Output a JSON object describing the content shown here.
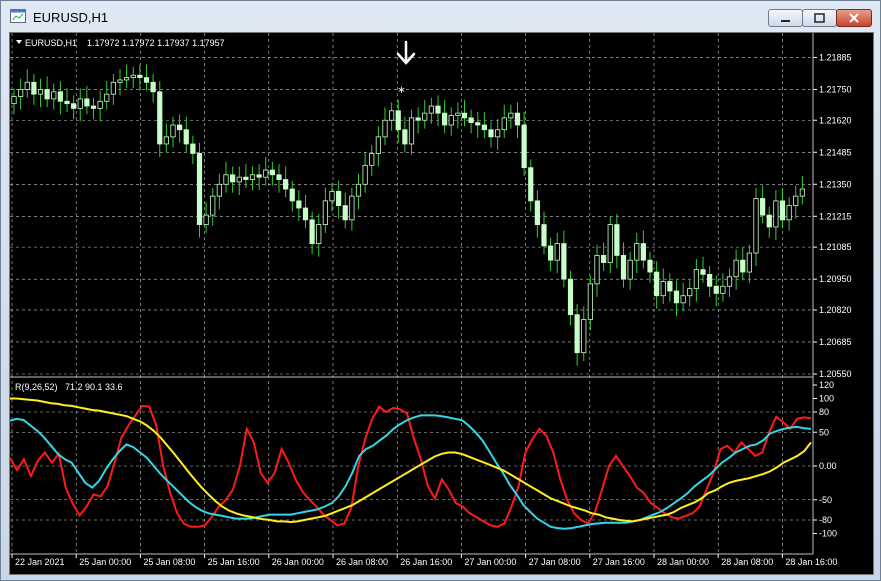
{
  "window": {
    "title": "EURUSD,H1",
    "buttons": [
      "minimize",
      "restore",
      "close"
    ]
  },
  "main_chart": {
    "symbol_label": "EURUSD,H1",
    "ohlc_label": "1.17972 1.17972 1.17937 1.17957"
  },
  "indicator": {
    "label": "R(9,26,52)",
    "values_label": "71.2 90.1 33.6"
  },
  "colors": {
    "background": "#000000",
    "grid": "#c8c8c8",
    "candle": "#c8ffc8",
    "wick": "#32cd32",
    "fast": "#ff1a1a",
    "mid": "#33d6e6",
    "slow": "#ffef1a"
  },
  "chart_data": [
    {
      "type": "candlestick",
      "title": "EURUSD,H1",
      "yticks": [
        "1.21885",
        "1.21750",
        "1.21620",
        "1.21485",
        "1.21350",
        "1.21215",
        "1.21085",
        "1.20950",
        "1.20820",
        "1.20685",
        "1.20550"
      ],
      "ylim": [
        1.2055,
        1.2195
      ],
      "xticks": [
        "22 Jan 2021",
        "25 Jan 00:00",
        "25 Jan 08:00",
        "25 Jan 16:00",
        "26 Jan 00:00",
        "26 Jan 08:00",
        "26 Jan 16:00",
        "27 Jan 00:00",
        "27 Jan 08:00",
        "27 Jan 16:00",
        "28 Jan 00:00",
        "28 Jan 08:00",
        "28 Jan 16:00"
      ],
      "grid": true,
      "closes": [
        1.2172,
        1.2175,
        1.2178,
        1.2173,
        1.2175,
        1.2171,
        1.2174,
        1.217,
        1.2169,
        1.2167,
        1.2171,
        1.2168,
        1.2167,
        1.217,
        1.2173,
        1.2178,
        1.2179,
        1.218,
        1.2181,
        1.218,
        1.2178,
        1.2174,
        1.2152,
        1.2155,
        1.216,
        1.2158,
        1.2152,
        1.2148,
        1.2118,
        1.2122,
        1.213,
        1.2135,
        1.2139,
        1.2136,
        1.2138,
        1.2137,
        1.2139,
        1.2138,
        1.2141,
        1.2139,
        1.2137,
        1.2133,
        1.2128,
        1.2125,
        1.212,
        1.211,
        1.2118,
        1.2128,
        1.2132,
        1.2126,
        1.212,
        1.213,
        1.2135,
        1.2143,
        1.2148,
        1.2155,
        1.2162,
        1.2166,
        1.2158,
        1.2152,
        1.2163,
        1.2162,
        1.2165,
        1.2168,
        1.2165,
        1.216,
        1.2164,
        1.2165,
        1.2163,
        1.2161,
        1.216,
        1.2158,
        1.2155,
        1.2158,
        1.2163,
        1.2165,
        1.216,
        1.2142,
        1.2128,
        1.2118,
        1.2109,
        1.2103,
        1.211,
        1.2095,
        1.208,
        1.2064,
        1.2078,
        1.2093,
        1.2105,
        1.2102,
        1.2118,
        1.2105,
        1.2095,
        1.2103,
        1.211,
        1.2103,
        1.2098,
        1.2088,
        1.2094,
        1.209,
        1.2085,
        1.2088,
        1.2091,
        1.2099,
        1.2097,
        1.2092,
        1.2089,
        1.2092,
        1.2096,
        1.2103,
        1.2098,
        1.2106,
        1.2129,
        1.2122,
        1.2117,
        1.2128,
        1.212,
        1.2126,
        1.213,
        1.2133
      ]
    },
    {
      "type": "line",
      "title": "R(9,26,52)",
      "yticks": [
        "120",
        "100",
        "80",
        "50",
        "0.00",
        "-50",
        "-80",
        "-100"
      ],
      "ylim": [
        -120,
        120
      ],
      "series": [
        {
          "values": [
            12,
            -6,
            10,
            -15,
            8,
            20,
            5,
            18,
            -32,
            -56,
            -73,
            -60,
            -42,
            -45,
            -30,
            5,
            42,
            60,
            75,
            89,
            88,
            60,
            0,
            -40,
            -70,
            -86,
            -90,
            -90,
            -88,
            -75,
            -60,
            -50,
            -35,
            0,
            55,
            35,
            -10,
            -25,
            -10,
            25,
            5,
            -20,
            -38,
            -50,
            -60,
            -72,
            -80,
            -88,
            -85,
            -62,
            0,
            40,
            70,
            88,
            80,
            86,
            84,
            78,
            40,
            10,
            -30,
            -48,
            -20,
            -35,
            -55,
            -60,
            -70,
            -76,
            -82,
            -88,
            -90,
            -85,
            -60,
            -30,
            20,
            40,
            55,
            45,
            20,
            -20,
            -50,
            -70,
            -80,
            -85,
            -68,
            -35,
            0,
            15,
            0,
            -15,
            -32,
            -40,
            -55,
            -62,
            -70,
            -76,
            -78,
            -74,
            -70,
            -60,
            -35,
            -10,
            25,
            30,
            20,
            35,
            25,
            15,
            20,
            50,
            73,
            65,
            55,
            70,
            72,
            71
          ]
        },
        {
          "values": [
            67,
            70,
            68,
            60,
            52,
            42,
            30,
            18,
            10,
            5,
            -10,
            -25,
            -32,
            -22,
            -5,
            10,
            22,
            32,
            28,
            20,
            12,
            0,
            -12,
            -22,
            -32,
            -42,
            -52,
            -60,
            -66,
            -70,
            -72,
            -74,
            -76,
            -78,
            -78,
            -78,
            -76,
            -74,
            -72,
            -72,
            -72,
            -72,
            -70,
            -68,
            -66,
            -64,
            -60,
            -55,
            -45,
            -30,
            -10,
            15,
            25,
            30,
            38,
            45,
            55,
            62,
            68,
            72,
            75,
            75,
            75,
            74,
            72,
            70,
            68,
            60,
            50,
            38,
            22,
            5,
            -10,
            -28,
            -42,
            -58,
            -68,
            -78,
            -84,
            -90,
            -92,
            -93,
            -92,
            -90,
            -88,
            -86,
            -85,
            -84,
            -84,
            -84,
            -84,
            -82,
            -80,
            -76,
            -72,
            -68,
            -62,
            -55,
            -48,
            -40,
            -30,
            -22,
            -15,
            -5,
            5,
            12,
            20,
            25,
            30,
            32,
            38,
            48,
            52,
            55,
            57,
            58,
            56,
            55
          ]
        },
        {
          "values": [
            100,
            100,
            99,
            98,
            97,
            95,
            93,
            92,
            90,
            89,
            87,
            85,
            83,
            82,
            80,
            78,
            76,
            74,
            70,
            66,
            60,
            52,
            42,
            30,
            18,
            5,
            -8,
            -20,
            -32,
            -42,
            -52,
            -60,
            -66,
            -70,
            -73,
            -75,
            -77,
            -79,
            -80,
            -82,
            -82,
            -83,
            -82,
            -80,
            -78,
            -76,
            -74,
            -70,
            -66,
            -62,
            -58,
            -52,
            -46,
            -40,
            -34,
            -28,
            -22,
            -16,
            -10,
            -4,
            2,
            8,
            14,
            18,
            20,
            20,
            18,
            14,
            10,
            6,
            2,
            -2,
            -6,
            -12,
            -18,
            -24,
            -30,
            -36,
            -42,
            -48,
            -52,
            -56,
            -60,
            -63,
            -66,
            -70,
            -72,
            -76,
            -78,
            -80,
            -81,
            -82,
            -80,
            -78,
            -76,
            -74,
            -72,
            -68,
            -62,
            -58,
            -54,
            -48,
            -40,
            -36,
            -30,
            -25,
            -22,
            -20,
            -18,
            -15,
            -12,
            -8,
            -2,
            5,
            10,
            15,
            22,
            35
          ]
        }
      ],
      "xticks": [
        "22 Jan 2021",
        "25 Jan 00:00",
        "25 Jan 08:00",
        "25 Jan 16:00",
        "26 Jan 00:00",
        "26 Jan 08:00",
        "26 Jan 16:00",
        "27 Jan 00:00",
        "27 Jan 08:00",
        "27 Jan 16:00",
        "28 Jan 00:00",
        "28 Jan 08:00",
        "28 Jan 16:00"
      ],
      "grid": true
    }
  ]
}
